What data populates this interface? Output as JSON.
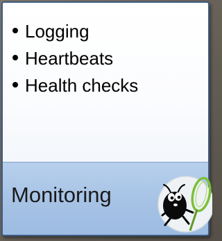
{
  "card": {
    "items": [
      {
        "label": "Logging"
      },
      {
        "label": "Heartbeats"
      },
      {
        "label": "Health checks"
      }
    ],
    "title": "Monitoring"
  },
  "mascot": {
    "icon": "bug-with-net-icon"
  },
  "colors": {
    "background": "#6e675d",
    "border": "#3e5d85",
    "footer": "#a7c3e5",
    "net_frame": "#7dbf3a"
  }
}
